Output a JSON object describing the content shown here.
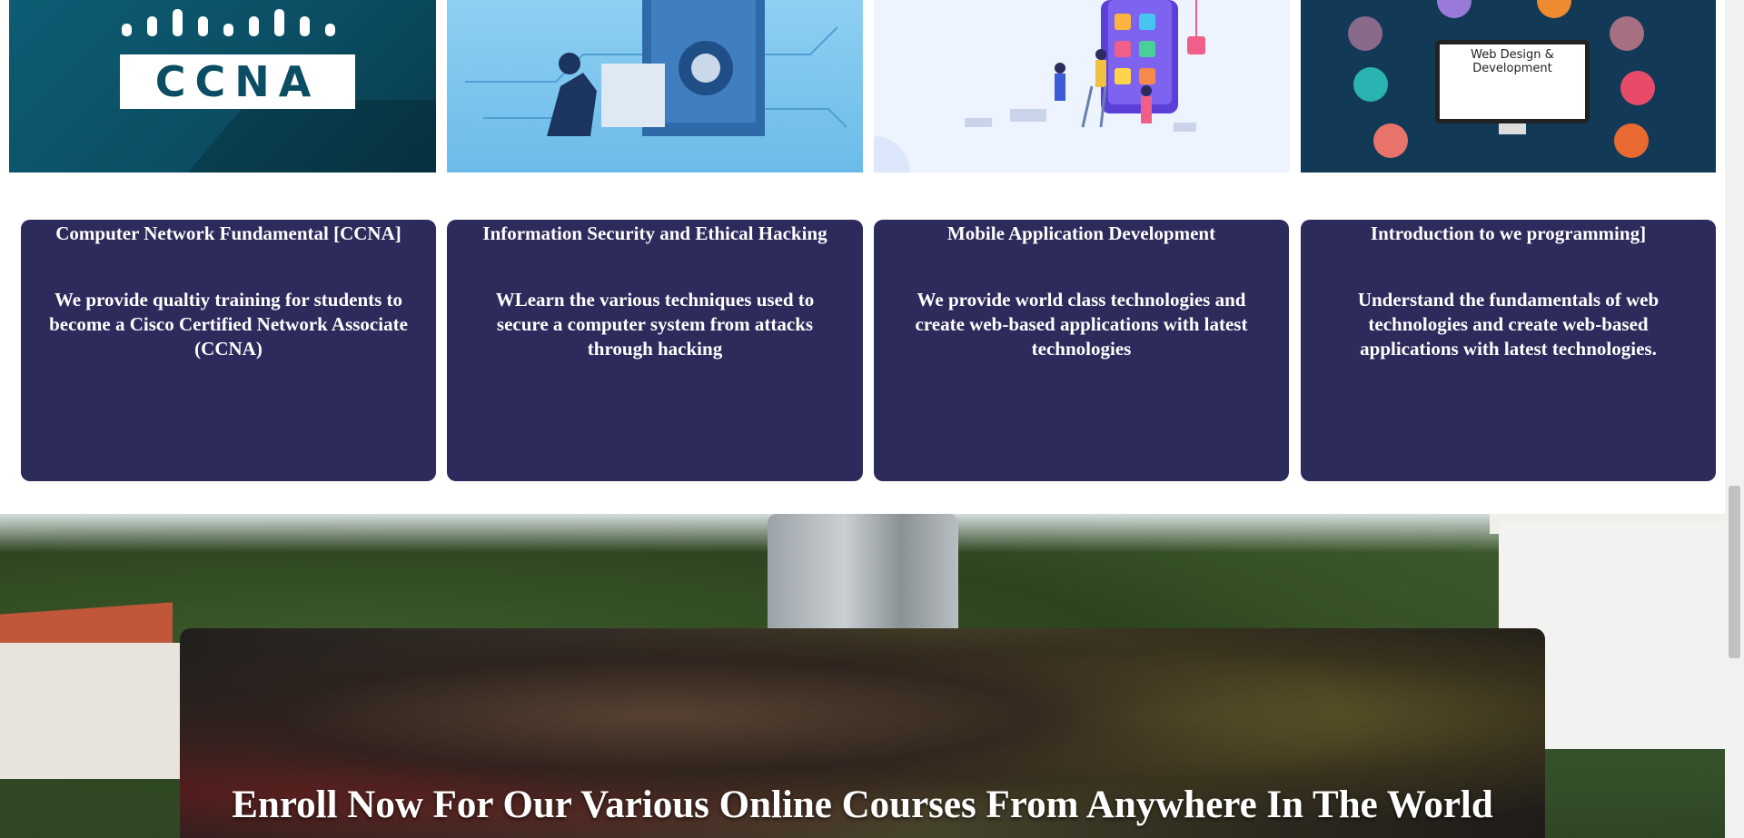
{
  "course_images": [
    {
      "name": "ccna-image",
      "logo_text": "CCNA"
    },
    {
      "name": "security-image"
    },
    {
      "name": "mobile-image"
    },
    {
      "name": "webdesign-image",
      "screen_text": "Web Design & Development"
    }
  ],
  "courses": [
    {
      "title": "Computer Network Fundamental [CCNA]",
      "description": "We provide qualtiy training for students to become a Cisco Certified Network Associate (CCNA)"
    },
    {
      "title": "Information Security and Ethical Hacking",
      "description": "WLearn the various techniques used to secure a computer system from attacks through hacking"
    },
    {
      "title": "Mobile Application Development",
      "description": "We provide world class technologies and create web-based applications with latest technologies"
    },
    {
      "title": "Introduction to we programming]",
      "description": "Understand the fundamentals of web technologies and create web-based applications with latest technologies."
    }
  ],
  "enroll": {
    "heading": "Enroll Now For Our Various Online Courses From Anywhere In The World"
  },
  "colors": {
    "card_bg": "#2d2a5c",
    "ccna_bg": "#0b4e63",
    "security_bg": "#8ed0f2",
    "webdesign_bg": "#123a57"
  }
}
